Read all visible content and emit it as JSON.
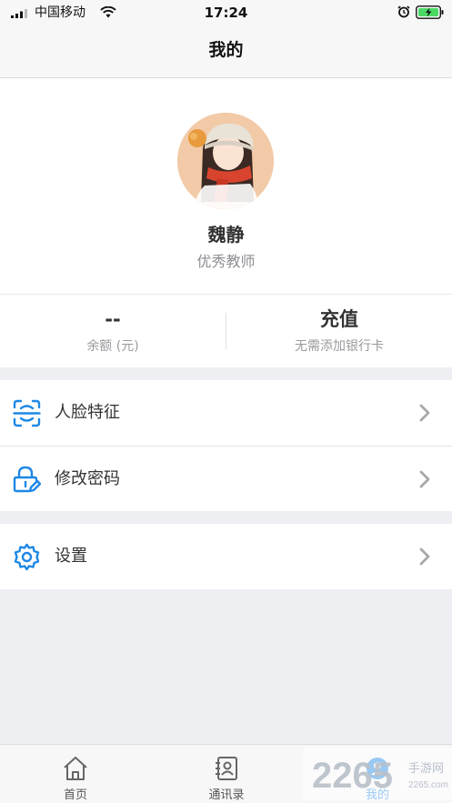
{
  "status_bar": {
    "carrier": "中国移动",
    "time": "17:24"
  },
  "nav": {
    "title": "我的"
  },
  "profile": {
    "name": "魏静",
    "role": "优秀教师"
  },
  "stats": {
    "balance_value": "--",
    "balance_label": "余额 (元)",
    "recharge_value": "充值",
    "recharge_label": "无需添加银行卡"
  },
  "menu": {
    "face": "人脸特征",
    "password": "修改密码",
    "settings": "设置"
  },
  "tabs": {
    "home": "首页",
    "contacts": "通讯录",
    "mine": "我的"
  },
  "watermark": {
    "number": "2265",
    "suffix": "手游网",
    "url": "2265.com"
  },
  "colors": {
    "accent": "#1e88e5",
    "text": "#333333",
    "muted": "#8e8e93",
    "background": "#eeeff3"
  },
  "icons": {
    "face": "face-scan-icon",
    "password": "lock-edit-icon",
    "settings": "gear-icon",
    "chevron": "chevron-right-icon",
    "home": "home-icon",
    "contacts": "contacts-icon",
    "mine": "user-icon"
  }
}
